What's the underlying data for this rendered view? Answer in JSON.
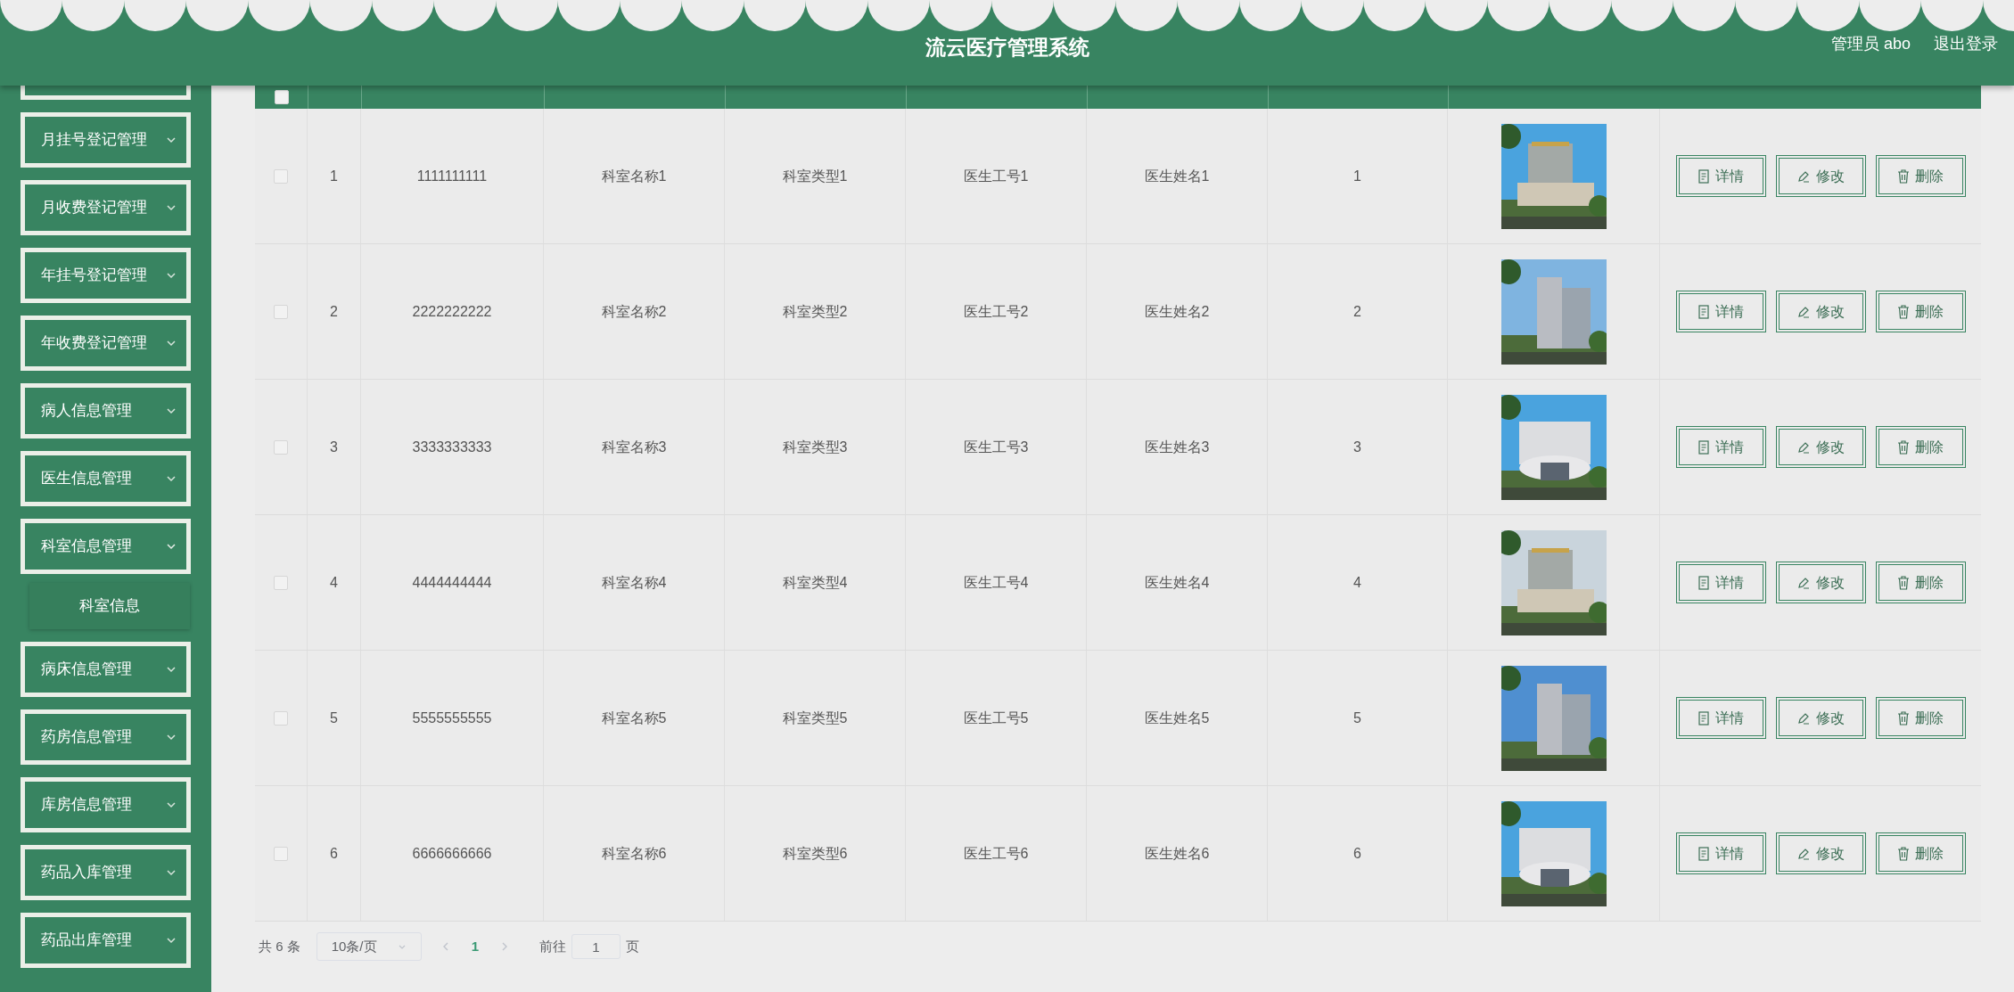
{
  "header": {
    "title": "流云医疗管理系统",
    "user": "管理员 abo",
    "logout": "退出登录"
  },
  "sidebar": {
    "items": [
      {
        "expanded": false
      },
      {
        "label": "月挂号登记管理",
        "expanded": false
      },
      {
        "label": "月收费登记管理",
        "expanded": false
      },
      {
        "label": "年挂号登记管理",
        "expanded": false
      },
      {
        "label": "年收费登记管理",
        "expanded": false
      },
      {
        "label": "病人信息管理",
        "expanded": false
      },
      {
        "label": "医生信息管理",
        "expanded": false
      },
      {
        "label": "科室信息管理",
        "expanded": true,
        "children": [
          {
            "label": "科室信息"
          }
        ]
      },
      {
        "label": "病床信息管理",
        "expanded": false
      },
      {
        "label": "药房信息管理",
        "expanded": false
      },
      {
        "label": "库房信息管理",
        "expanded": false
      },
      {
        "label": "药品入库管理",
        "expanded": false
      },
      {
        "label": "药品出库管理",
        "expanded": false
      }
    ]
  },
  "table": {
    "header_checkbox": {
      "checked": false
    },
    "rows": [
      {
        "checked": false,
        "cells": [
          "1",
          "1111111111",
          "科室名称1",
          "科室类型1",
          "医生工号1",
          "医生姓名1",
          "1"
        ],
        "actions": [
          "详情",
          "修改",
          "删除"
        ]
      },
      {
        "checked": false,
        "cells": [
          "2",
          "2222222222",
          "科室名称2",
          "科室类型2",
          "医生工号2",
          "医生姓名2",
          "2"
        ],
        "actions": [
          "详情",
          "修改",
          "删除"
        ]
      },
      {
        "checked": false,
        "cells": [
          "3",
          "3333333333",
          "科室名称3",
          "科室类型3",
          "医生工号3",
          "医生姓名3",
          "3"
        ],
        "actions": [
          "详情",
          "修改",
          "删除"
        ]
      },
      {
        "checked": false,
        "cells": [
          "4",
          "4444444444",
          "科室名称4",
          "科室类型4",
          "医生工号4",
          "医生姓名4",
          "4"
        ],
        "actions": [
          "详情",
          "修改",
          "删除"
        ]
      },
      {
        "checked": false,
        "cells": [
          "5",
          "5555555555",
          "科室名称5",
          "科室类型5",
          "医生工号5",
          "医生姓名5",
          "5"
        ],
        "actions": [
          "详情",
          "修改",
          "删除"
        ]
      },
      {
        "checked": false,
        "cells": [
          "6",
          "6666666666",
          "科室名称6",
          "科室类型6",
          "医生工号6",
          "医生姓名6",
          "6"
        ],
        "actions": [
          "详情",
          "修改",
          "删除"
        ]
      }
    ]
  },
  "pagination": {
    "total": "共 6 条",
    "page_size": "10条/页",
    "pages": [
      {
        "label": "1",
        "selected": true
      }
    ],
    "goto_label": "前往",
    "goto_value": "1",
    "goto_suffix": "页"
  }
}
